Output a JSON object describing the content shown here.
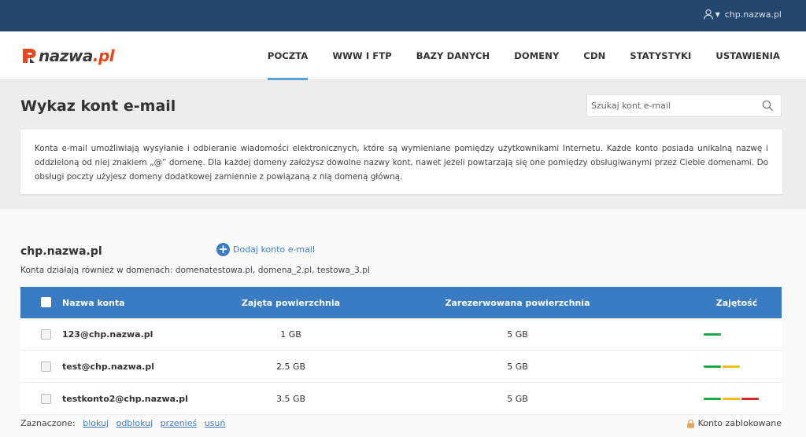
{
  "topbar": {
    "account_label": "chp.nazwa.pl"
  },
  "logo": {
    "name": "nazwa",
    "tld": ".pl"
  },
  "nav": [
    {
      "label": "POCZTA",
      "active": true
    },
    {
      "label": "WWW I FTP"
    },
    {
      "label": "BAZY DANYCH"
    },
    {
      "label": "DOMENY"
    },
    {
      "label": "CDN"
    },
    {
      "label": "STATYSTYKI"
    },
    {
      "label": "USTAWIENIA"
    }
  ],
  "page": {
    "title": "Wykaz kont e-mail",
    "search_placeholder": "Szukaj kont e-mail",
    "info": "Konta e-mail umożliwiają wysyłanie i odbieranie wiadomości elektronicznych, które są wymieniane pomiędzy użytkownikami Internetu.  Każde konto posiada unikalną nazwę i oddzieloną od niej znakiem „@” domenę. Dla każdej domeny założysz dowolne nazwy kont, nawet jeżeli powtarzają się one pomiędzy obsługiwanymi przez Ciebie domenami. Do obsługi poczty użyjesz domeny dodatkowej zamiennie z powiązaną z nią domeną główną."
  },
  "domain": {
    "name": "chp.nazwa.pl",
    "add_label": "Dodaj konto e-mail",
    "aliases_text": "Konta działają również w domenach:  domenatestowa.pl, domena_2.pl, testowa_3.pl"
  },
  "table": {
    "headers": {
      "name": "Nazwa konta",
      "used": "Zajęta powierzchnia",
      "reserved": "Zarezerwowana powierzchnia",
      "usage": "Zajętość"
    },
    "rows": [
      {
        "name": "123@chp.nazwa.pl",
        "used": "1 GB",
        "reserved": "5 GB",
        "usage_level": 1
      },
      {
        "name": "test@chp.nazwa.pl",
        "used": "2.5 GB",
        "reserved": "5 GB",
        "usage_level": 2
      },
      {
        "name": "testkonto2@chp.nazwa.pl",
        "used": "3.5 GB",
        "reserved": "5 GB",
        "usage_level": 3
      }
    ]
  },
  "footer": {
    "selected_label": "Zaznaczone:",
    "actions": [
      "blokuj",
      "odblokuj",
      "przenieś",
      "usuń"
    ],
    "locked_label": "Konto zablokowane"
  },
  "colors": {
    "topbar": "#23476f",
    "accent": "#3a7cc3",
    "brand": "#e8461e",
    "usage_green": "#1fa84a",
    "usage_yellow": "#f3bd1c",
    "usage_red": "#d8262a"
  }
}
